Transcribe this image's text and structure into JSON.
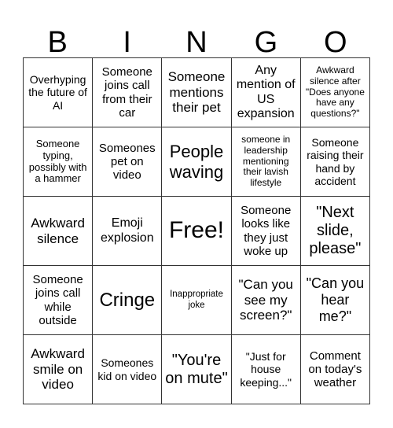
{
  "header": {
    "letters": [
      "B",
      "I",
      "N",
      "G",
      "O"
    ]
  },
  "board": {
    "cells": [
      "Overhyping the future of AI",
      "Someone joins call from their car",
      "Someone mentions their pet",
      "Any mention of US expansion",
      "Awkward silence after \"Does anyone have any questions?\"",
      "Someone typing, possibly with a hammer",
      "Someones pet on video",
      "People waving",
      "someone in leadership mentioning their lavish lifestyle",
      "Someone raising their hand by accident",
      "Awkward silence",
      "Emoji explosion",
      "Free!",
      "Someone looks like they just woke up",
      "\"Next slide, please\"",
      "Someone joins call while outside",
      "Cringe",
      "Inappropriate joke",
      "\"Can you see my screen?\"",
      "\"Can you hear me?\"",
      "Awkward smile on video",
      "Someones kid on video",
      "\"You're on mute\"",
      "\"Just for house keeping...\"",
      "Comment on today's weather"
    ]
  }
}
